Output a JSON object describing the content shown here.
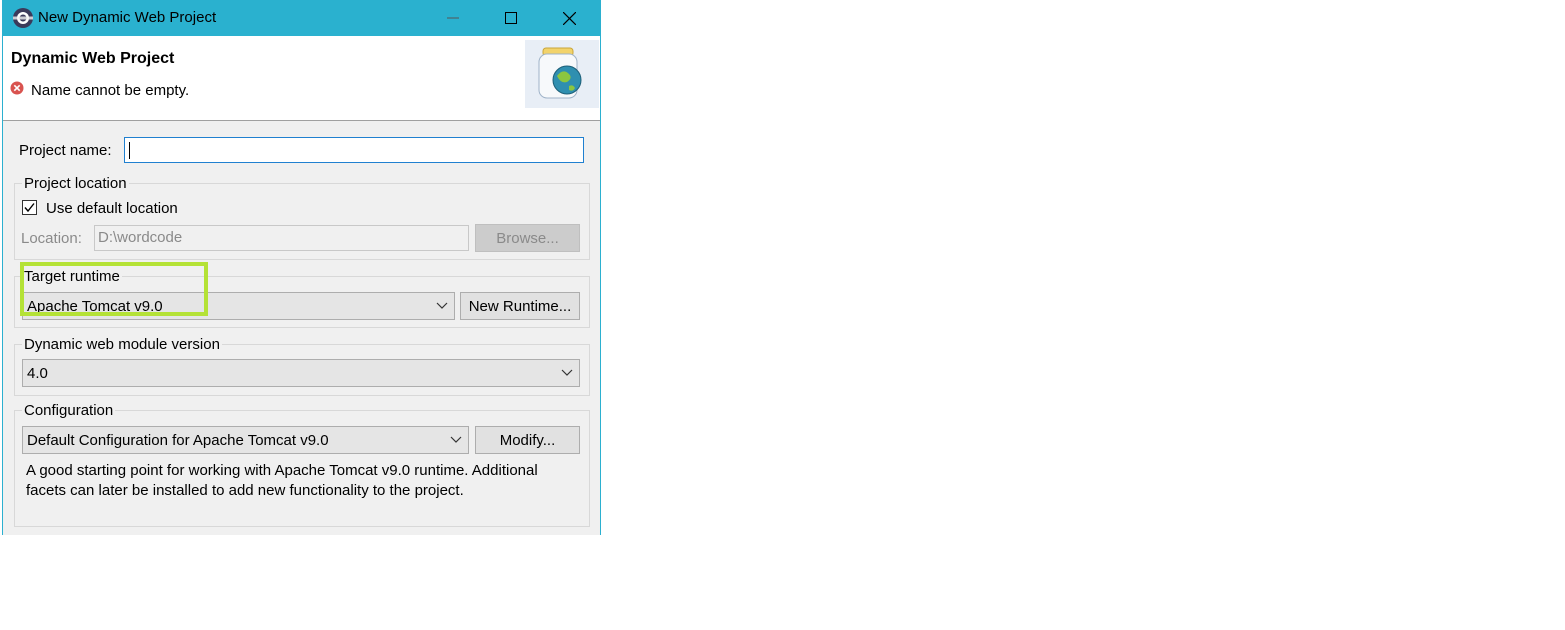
{
  "window": {
    "title": "New Dynamic Web Project",
    "titlebar_color": "#2ab1cf",
    "controls": [
      "minimize-icon",
      "maximize-icon",
      "close-icon"
    ]
  },
  "header": {
    "title": "Dynamic Web Project",
    "error_message": "Name cannot be empty.",
    "error_icon": "error-icon",
    "banner_icon": "web-project-jar-globe-icon"
  },
  "project_name": {
    "label": "Project name:",
    "value": ""
  },
  "project_location": {
    "group_label": "Project location",
    "use_default_label": "Use default location",
    "use_default_checked": true,
    "location_label": "Location:",
    "location_value": "D:\\wordcode",
    "browse_label": "Browse..."
  },
  "target_runtime": {
    "group_label": "Target runtime",
    "selected": "Apache Tomcat v9.0",
    "new_runtime_label": "New Runtime...",
    "highlight_color": "#b4e236"
  },
  "module_version": {
    "group_label": "Dynamic web module version",
    "selected": "4.0"
  },
  "configuration": {
    "group_label": "Configuration",
    "selected": "Default Configuration for Apache Tomcat v9.0",
    "modify_label": "Modify...",
    "description": "A good starting point for working with Apache Tomcat v9.0 runtime. Additional facets can later be installed to add new functionality to the project."
  }
}
